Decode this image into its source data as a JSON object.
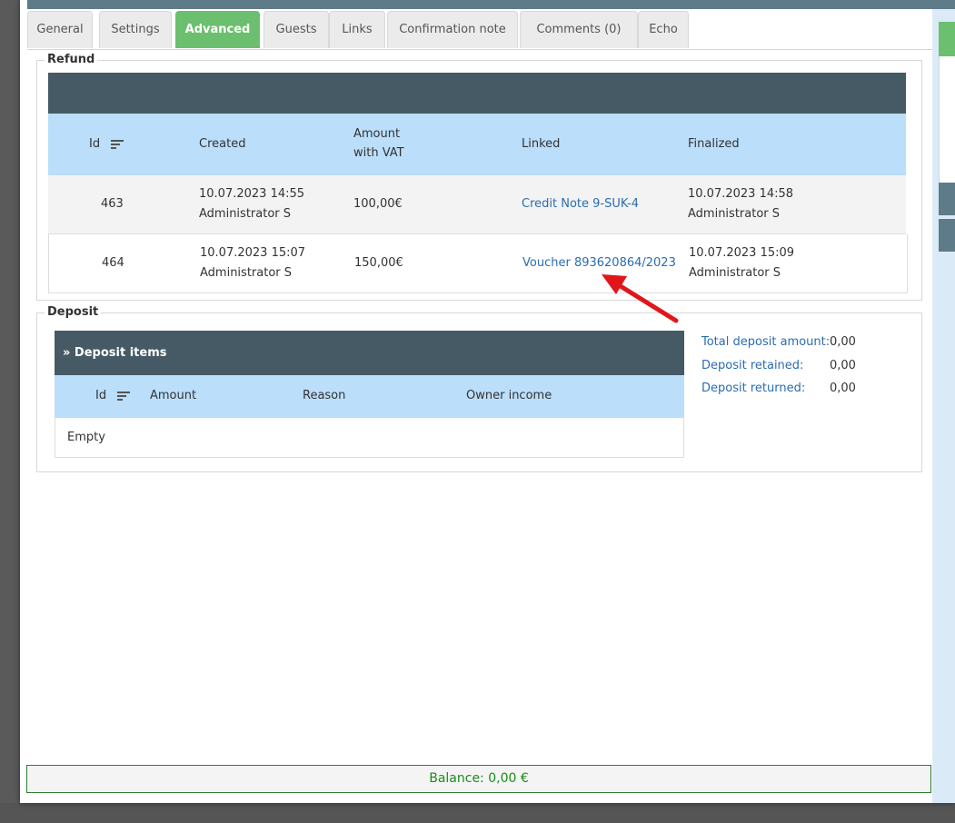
{
  "tabs": [
    {
      "label": "General"
    },
    {
      "label": "Settings"
    },
    {
      "label": "Advanced"
    },
    {
      "label": "Guests"
    },
    {
      "label": "Links"
    },
    {
      "label": "Confirmation note"
    },
    {
      "label": "Comments (0)"
    },
    {
      "label": "Echo"
    }
  ],
  "active_tab": "Advanced",
  "refund": {
    "legend": "Refund",
    "headers": {
      "id": "Id",
      "created": "Created",
      "amount_line1": "Amount",
      "amount_line2": "with VAT",
      "linked": "Linked",
      "finalized": "Finalized"
    },
    "rows": [
      {
        "id": "463",
        "created_date": "10.07.2023 14:55",
        "created_by": "Administrator S",
        "amount": "100,00€",
        "linked": "Credit Note 9-SUK-4",
        "finalized_date": "10.07.2023 14:58",
        "finalized_by": "Administrator S"
      },
      {
        "id": "464",
        "created_date": "10.07.2023 15:07",
        "created_by": "Administrator S",
        "amount": "150,00€",
        "linked": "Voucher 893620864/2023",
        "finalized_date": "10.07.2023 15:09",
        "finalized_by": "Administrator S"
      }
    ]
  },
  "deposit": {
    "legend": "Deposit",
    "items_title": "» Deposit items",
    "headers": {
      "id": "Id",
      "amount": "Amount",
      "reason": "Reason",
      "owner_income": "Owner income"
    },
    "empty_text": "Empty",
    "summary": [
      {
        "label": "Total deposit amount:",
        "value": "0,00"
      },
      {
        "label": "Deposit retained:",
        "value": "0,00"
      },
      {
        "label": "Deposit returned:",
        "value": "0,00"
      }
    ]
  },
  "balance": "Balance: 0,00 €",
  "colors": {
    "accent_green": "#6cbf6e",
    "table_dark": "#455a64",
    "table_header": "#bbdefb",
    "link": "#2b6cb0",
    "balance_text": "#1b8c1b",
    "arrow": "#e0161b"
  }
}
